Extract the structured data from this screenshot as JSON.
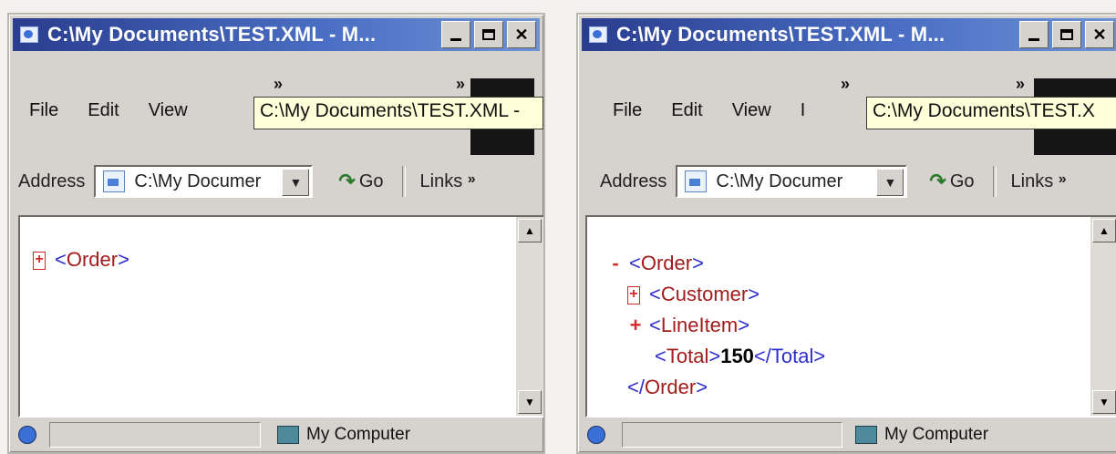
{
  "windows": [
    {
      "title": "C:\\My Documents\\TEST.XML - M...",
      "menu": [
        "File",
        "Edit",
        "View"
      ],
      "menu_extra": "",
      "menu_chevron": "»",
      "tooltip": "C:\\My Documents\\TEST.XML -",
      "address_label": "Address",
      "address_value": "C:\\My Documer",
      "go_label": "Go",
      "links_label": "Links",
      "links_chevron": "»",
      "xml_lines": [
        {
          "marker": "+",
          "indent": 0,
          "open": "<",
          "tag": "Order",
          "close": ">",
          "value": "",
          "end": ""
        }
      ],
      "status_text": "My Computer"
    },
    {
      "title": "C:\\My Documents\\TEST.XML - M...",
      "menu": [
        "File",
        "Edit",
        "View"
      ],
      "menu_extra": "I",
      "menu_chevron": "»",
      "tooltip": "C:\\My Documents\\TEST.X",
      "address_label": "Address",
      "address_value": "C:\\My Documer",
      "go_label": "Go",
      "links_label": "Links",
      "links_chevron": "»",
      "xml_lines": [
        {
          "marker": "-",
          "indent": 0,
          "open": "<",
          "tag": "Order",
          "close": ">",
          "value": "",
          "end": ""
        },
        {
          "marker": "+",
          "indent": 1,
          "open": "<",
          "tag": "Customer",
          "close": ">",
          "value": "",
          "end": ""
        },
        {
          "marker": "+",
          "indent": 1,
          "open": "<",
          "tag": "LineItem",
          "close": ">",
          "value": "",
          "end": ""
        },
        {
          "marker": "",
          "indent": 2,
          "open": "<",
          "tag": "Total",
          "close": ">",
          "value": "150",
          "end": "</Total>"
        },
        {
          "marker": "",
          "indent": 1,
          "open": "</",
          "tag": "Order",
          "close": ">",
          "value": "",
          "end": ""
        }
      ],
      "status_text": "My Computer"
    }
  ]
}
